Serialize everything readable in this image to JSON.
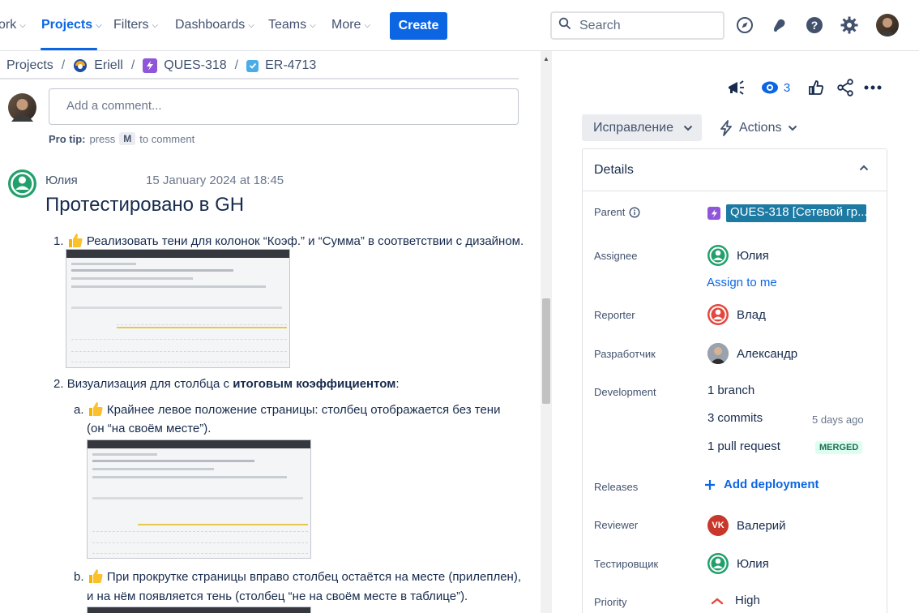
{
  "nav": {
    "items": [
      "ork",
      "Projects",
      "Filters",
      "Dashboards",
      "Teams",
      "More"
    ],
    "create_label": "Create",
    "search_placeholder": "Search"
  },
  "breadcrumb": {
    "items": [
      "Projects",
      "Eriell",
      "QUES-318",
      "ER-4713"
    ]
  },
  "comment": {
    "placeholder": "Add a comment...",
    "protip_label": "Pro tip:",
    "protip_text_before": "press",
    "protip_key": "M",
    "protip_text_after": "to comment"
  },
  "post": {
    "author": "Юлия",
    "timestamp": "15 January 2024 at 18:45",
    "heading": "Протестировано в GH",
    "item1_num": "1.",
    "item1_text": "Реализовать тени для колонок “Коэф.” и “Сумма” в соответствии с дизайном.",
    "item2_num": "2.",
    "item2_text": "Визуализация для столбца с ",
    "item2_bold": "итоговым коэффициентом",
    "item2_colon": ":",
    "sub_a_letter": "a.",
    "sub_a_line1": "Крайнее левое положение страницы: столбец отображается без тени",
    "sub_a_line2": "(он “на своём месте”).",
    "sub_b_letter": "b.",
    "sub_b_line1": "При прокрутке страницы вправо столбец остаётся на месте (прилеплен),",
    "sub_b_line2": "и на нём появляется тень (столбец “не на своём месте в таблице”)."
  },
  "issue": {
    "watchers_count": "3",
    "status": "Исправление",
    "actions_label": "Actions",
    "details_title": "Details",
    "fields": {
      "parent_label": "Parent",
      "parent_value": "QUES-318 [Сетевой гр...",
      "assignee_label": "Assignee",
      "assignee_value": "Юлия",
      "assign_to_me": "Assign to me",
      "reporter_label": "Reporter",
      "reporter_value": "Влад",
      "developer_label": "Разработчик",
      "developer_value": "Александр",
      "development_label": "Development",
      "branch_count": "1",
      "branch_text": "branch",
      "commits_count": "3",
      "commits_text": "commits",
      "commits_age": "5 days ago",
      "pr_count": "1",
      "pr_text": "pull request",
      "pr_status": "MERGED",
      "releases_label": "Releases",
      "add_deployment": "Add deployment",
      "reviewer_label": "Reviewer",
      "reviewer_initials": "VK",
      "reviewer_value": "Валерий",
      "tester_label": "Тестировщик",
      "tester_value": "Юлия",
      "priority_label": "Priority",
      "priority_value": "High"
    }
  },
  "colors": {
    "accent": "#0c66e4",
    "green_avatar": "#22a06b",
    "reporter_avatar": "#e2483d",
    "reviewer_avatar": "#c9372c",
    "parent_chip": "#1d7aa3",
    "merged_bg": "#dcfff1"
  },
  "icons": [
    "search-icon",
    "compass-icon",
    "bell-icon",
    "help-icon",
    "gear-icon",
    "megaphone-icon",
    "eye-icon",
    "thumbs-up-icon",
    "share-icon",
    "more-icon",
    "lightning-icon",
    "info-icon",
    "plus-icon",
    "priority-high-icon"
  ]
}
